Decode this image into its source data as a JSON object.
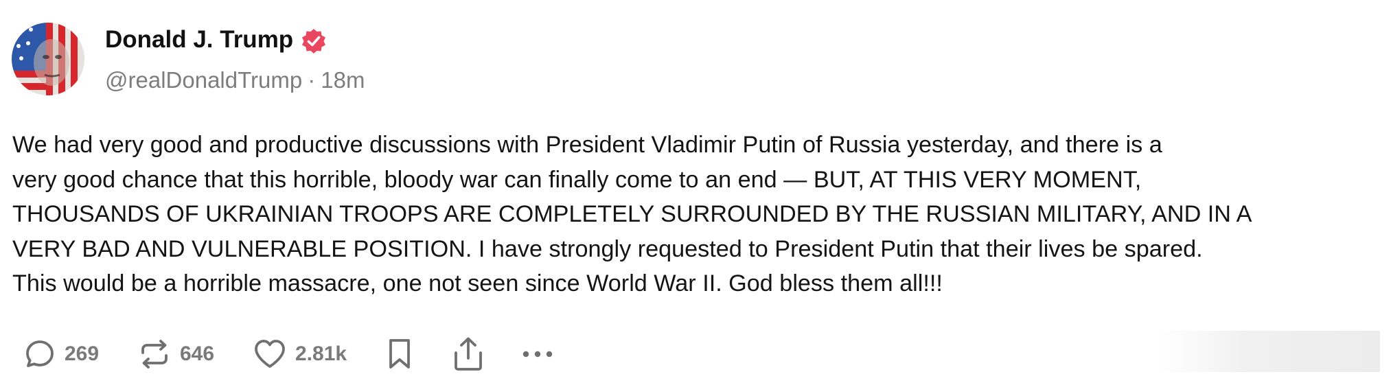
{
  "post": {
    "author": {
      "display_name": "Donald J. Trump",
      "handle": "@realDonaldTrump",
      "verified": true,
      "avatar_icon": "avatar-image"
    },
    "separator": "·",
    "time": "18m",
    "text": "We had very good and productive discussions with President Vladimir Putin of Russia yesterday, and there is a\nvery good chance that this horrible, bloody war can finally come to an end — BUT, AT THIS VERY MOMENT,\nTHOUSANDS OF UKRAINIAN TROOPS ARE COMPLETELY SURROUNDED BY THE RUSSIAN MILITARY, AND IN A\nVERY BAD AND VULNERABLE POSITION. I have strongly requested to President Putin that their lives be spared.\nThis would be a horrible massacre, one not seen since World War II. God bless them all!!!",
    "actions": {
      "reply": {
        "icon": "reply-icon",
        "count": "269"
      },
      "repost": {
        "icon": "repost-icon",
        "count": "646"
      },
      "like": {
        "icon": "heart-icon",
        "count": "2.81k"
      },
      "bookmark": {
        "icon": "bookmark-icon"
      },
      "share": {
        "icon": "share-icon"
      },
      "more": {
        "icon": "more-icon"
      }
    }
  },
  "colors": {
    "verified_badge": "#e8475f",
    "icon_gray": "#6f6f6f",
    "meta_gray": "#7d7d7d",
    "text": "#141414"
  }
}
